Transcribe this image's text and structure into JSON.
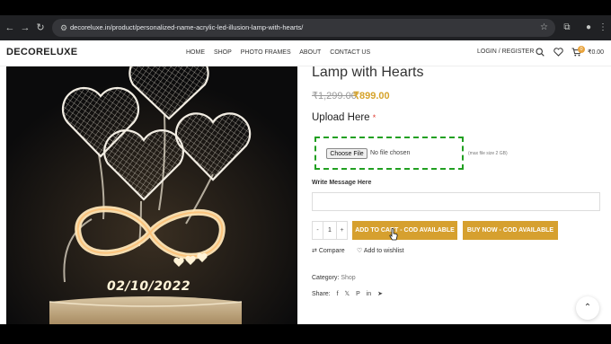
{
  "browser": {
    "url": "decoreluxe.in/product/personalized-name-acrylic-led-illusion-lamp-with-hearts/"
  },
  "site": {
    "logo": "DECORELUXE",
    "menu": [
      "HOME",
      "SHOP",
      "PHOTO FRAMES",
      "ABOUT",
      "CONTACT US"
    ],
    "login": "LOGIN / REGISTER",
    "cart_count": "0",
    "cart_total": "₹0.00"
  },
  "product": {
    "title": "Lamp with Hearts",
    "old_price": "₹1,299.00",
    "new_price": "₹899.00",
    "lamp_date": "02/10/2022"
  },
  "upload": {
    "title": "Upload Here",
    "required_mark": "*",
    "choose_file": "Choose File",
    "no_file": "No file chosen",
    "max_size": "(max file size 2 GB)"
  },
  "message": {
    "label": "Write Message Here",
    "value": ""
  },
  "cart": {
    "qty_minus": "-",
    "qty": "1",
    "qty_plus": "+",
    "add_to_cart": "ADD TO CART - COD AVAILABLE",
    "buy_now": "BUY NOW - COD AVAILABLE"
  },
  "actions": {
    "compare": "Compare",
    "wishlist": "Add to wishlist"
  },
  "meta": {
    "category_label": "Category:",
    "category_value": "Shop",
    "share_label": "Share:",
    "share_icons": [
      "f",
      "𝕏",
      "P",
      "in",
      "➤"
    ]
  },
  "colors": {
    "accent": "#d6a02f",
    "upload_border": "#21a021",
    "browser_bar": "#202124"
  }
}
